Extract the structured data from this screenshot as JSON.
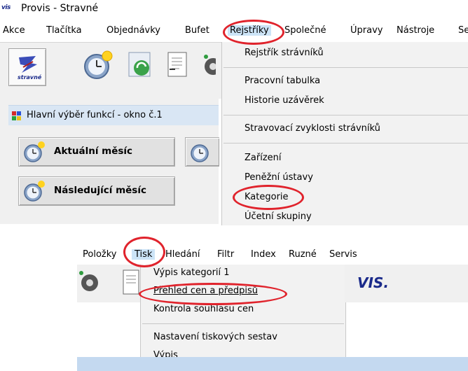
{
  "window": {
    "logo_text": "vis",
    "title": "Provis - Stravné"
  },
  "menu": [
    "Akce",
    "Tlačítka",
    "Objednávky",
    "Bufet",
    "Rejstříky",
    "Společné",
    "Úpravy",
    "Nástroje",
    "Se"
  ],
  "toolbar": {
    "stravne_label": "stravné"
  },
  "panel": {
    "title": "Hlavní výběr funkcí - okno č.1",
    "buttons": [
      "Aktuální měsíc",
      "Následující měsíc"
    ]
  },
  "rejstriky_dropdown": [
    "Rejstřík strávníků",
    "Pracovní tabulka",
    "Historie uzávěrek",
    "Stravovací zvyklosti strávníků",
    "Zařízení",
    "Peněžní ústavy",
    "Kategorie",
    "Účetní skupiny"
  ],
  "menu2": [
    "Položky",
    "Tisk",
    "Hledání",
    "Filtr",
    "Index",
    "Ruzné",
    "Servis"
  ],
  "tisk_dropdown": [
    "Výpis kategorií 1",
    "Přehled cen a předpisů",
    "Kontrola souhlasu cen",
    "Nastavení tiskových sestav",
    "Výpis"
  ],
  "vis_logo": "VIS.",
  "colors": {
    "highlight": "#e0232c",
    "panel_title_bg": "#d9e6f4",
    "brand_blue": "#1a2a8a"
  }
}
